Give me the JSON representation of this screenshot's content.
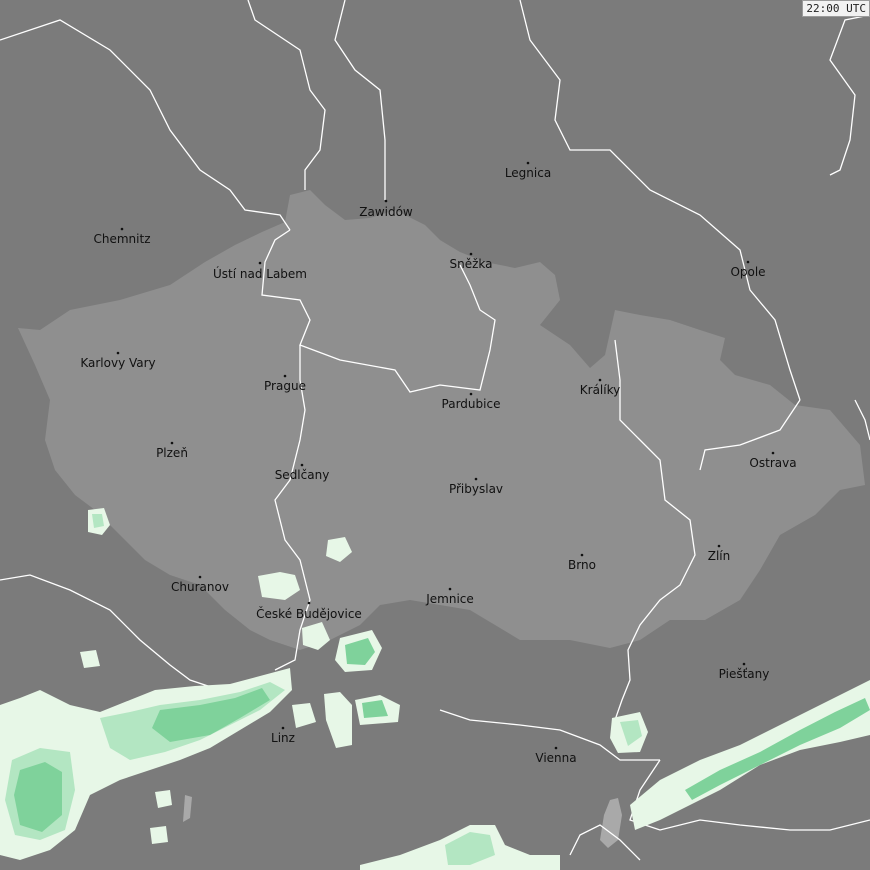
{
  "timestamp": "22:00 UTC",
  "colors": {
    "outside": "#7b7b7b",
    "country": "#8f8f8f",
    "border": "#ffffff",
    "precip_light": "#e7f7e7",
    "precip_mid": "#b3e6c2",
    "precip_heavy": "#7fd29b",
    "lake": "#a9a9a9"
  },
  "cities": [
    {
      "name": "Legnica"
    },
    {
      "name": "Zawidów"
    },
    {
      "name": "Chemnitz"
    },
    {
      "name": "Ústí nad Labem"
    },
    {
      "name": "Sněžka"
    },
    {
      "name": "Opole"
    },
    {
      "name": "Karlovy Vary"
    },
    {
      "name": "Prague"
    },
    {
      "name": "Králíky"
    },
    {
      "name": "Pardubice"
    },
    {
      "name": "Plzeň"
    },
    {
      "name": "Ostrava"
    },
    {
      "name": "Sedlčany"
    },
    {
      "name": "Přibyslav"
    },
    {
      "name": "Zlín"
    },
    {
      "name": "Brno"
    },
    {
      "name": "Churanov"
    },
    {
      "name": "České Budějovice"
    },
    {
      "name": "Jemnice"
    },
    {
      "name": "Piešťany"
    },
    {
      "name": "Linz"
    },
    {
      "name": "Vienna"
    }
  ]
}
